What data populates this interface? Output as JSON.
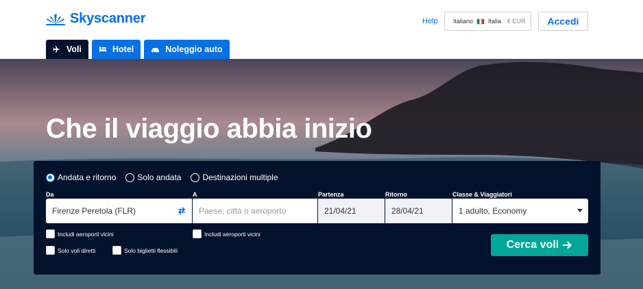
{
  "brand": {
    "name": "Skyscanner",
    "color": "#0770e3"
  },
  "header": {
    "help": "Help",
    "locale": {
      "language": "Italiano",
      "country": "Italia",
      "currency": "€ EUR"
    },
    "login": "Accedi"
  },
  "tabs": [
    {
      "label": "Voli",
      "icon": "plane-icon",
      "active": true
    },
    {
      "label": "Hotel",
      "icon": "bed-icon",
      "active": false
    },
    {
      "label": "Noleggio auto",
      "icon": "car-icon",
      "active": false
    }
  ],
  "hero": {
    "title": "Che il viaggio abbia inizio"
  },
  "search": {
    "trip_types": [
      {
        "label": "Andata e ritorno",
        "selected": true
      },
      {
        "label": "Solo andata",
        "selected": false
      },
      {
        "label": "Destinazioni multiple",
        "selected": false
      }
    ],
    "from": {
      "label": "Da",
      "value": "Firenze Peretola (FLR)"
    },
    "to": {
      "label": "A",
      "placeholder": "Paese, città o aeroporto"
    },
    "depart": {
      "label": "Partenza",
      "value": "21/04/21"
    },
    "return": {
      "label": "Ritorno",
      "value": "28/04/21"
    },
    "cabin": {
      "label": "Classe & Viaggiatori",
      "value": "1 adulto, Economy"
    },
    "checkboxes": {
      "nearby_from": "Includi aeroporti vicini",
      "nearby_to": "Includi aeroporti vicini",
      "direct": "Solo voli diretti",
      "flexible": "Solo biglietti flessibili"
    },
    "submit": "Cerca voli"
  },
  "colors": {
    "panel": "#02122c",
    "cta": "#00a698",
    "tab": "#0770e3"
  }
}
